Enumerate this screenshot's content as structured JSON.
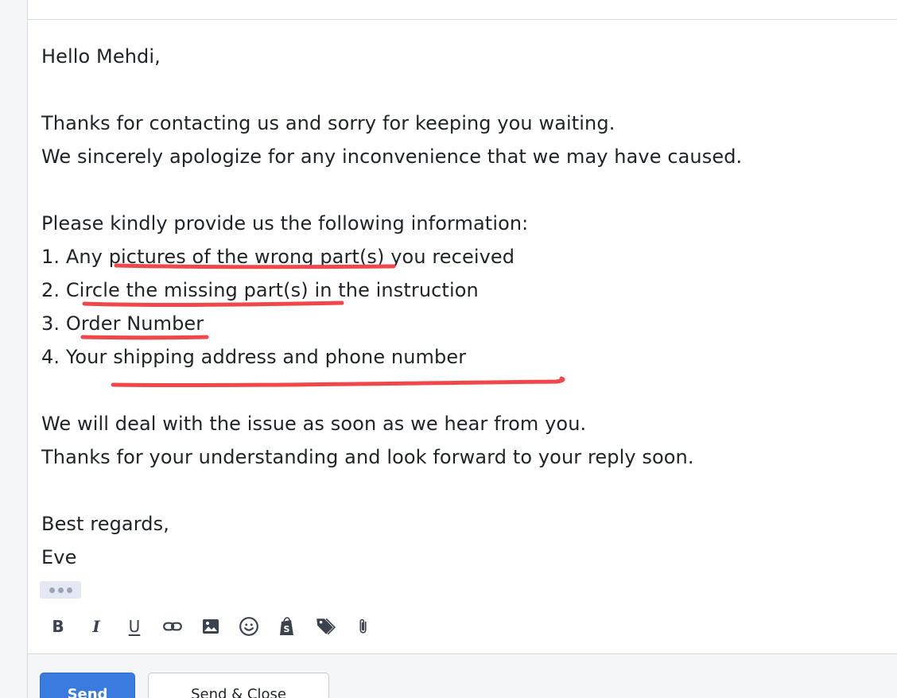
{
  "email": {
    "greeting": "Hello Mehdi,",
    "para1_line1": "Thanks for contacting us and sorry for keeping you waiting.",
    "para1_line2": "We sincerely apologize for any inconvenience that we may have caused.",
    "list_intro": "Please kindly provide us the following information:",
    "items": [
      "1. Any pictures of the wrong part(s) you received",
      "2. Circle the missing part(s) in the instruction",
      "3. Order Number",
      "4. Your shipping address and phone number"
    ],
    "para3_line1": "We will deal with the issue as soon as we hear from you.",
    "para3_line2": "Thanks for your understanding and look forward to your reply soon.",
    "signoff": "Best regards,",
    "signature": "Eve"
  },
  "annotation_color": "#f0484a",
  "toolbar": {
    "bold_label": "B",
    "italic_label": "I",
    "underline_label": "U",
    "icons": [
      "link-icon",
      "image-icon",
      "emoji-icon",
      "shopify-icon",
      "tag-icon",
      "attachment-icon"
    ]
  },
  "actions": {
    "send_label": "Send",
    "send_close_label": "Send & Close"
  },
  "colors": {
    "primary": "#3a7be0",
    "text": "#1f2328",
    "icon": "#3b4250"
  }
}
